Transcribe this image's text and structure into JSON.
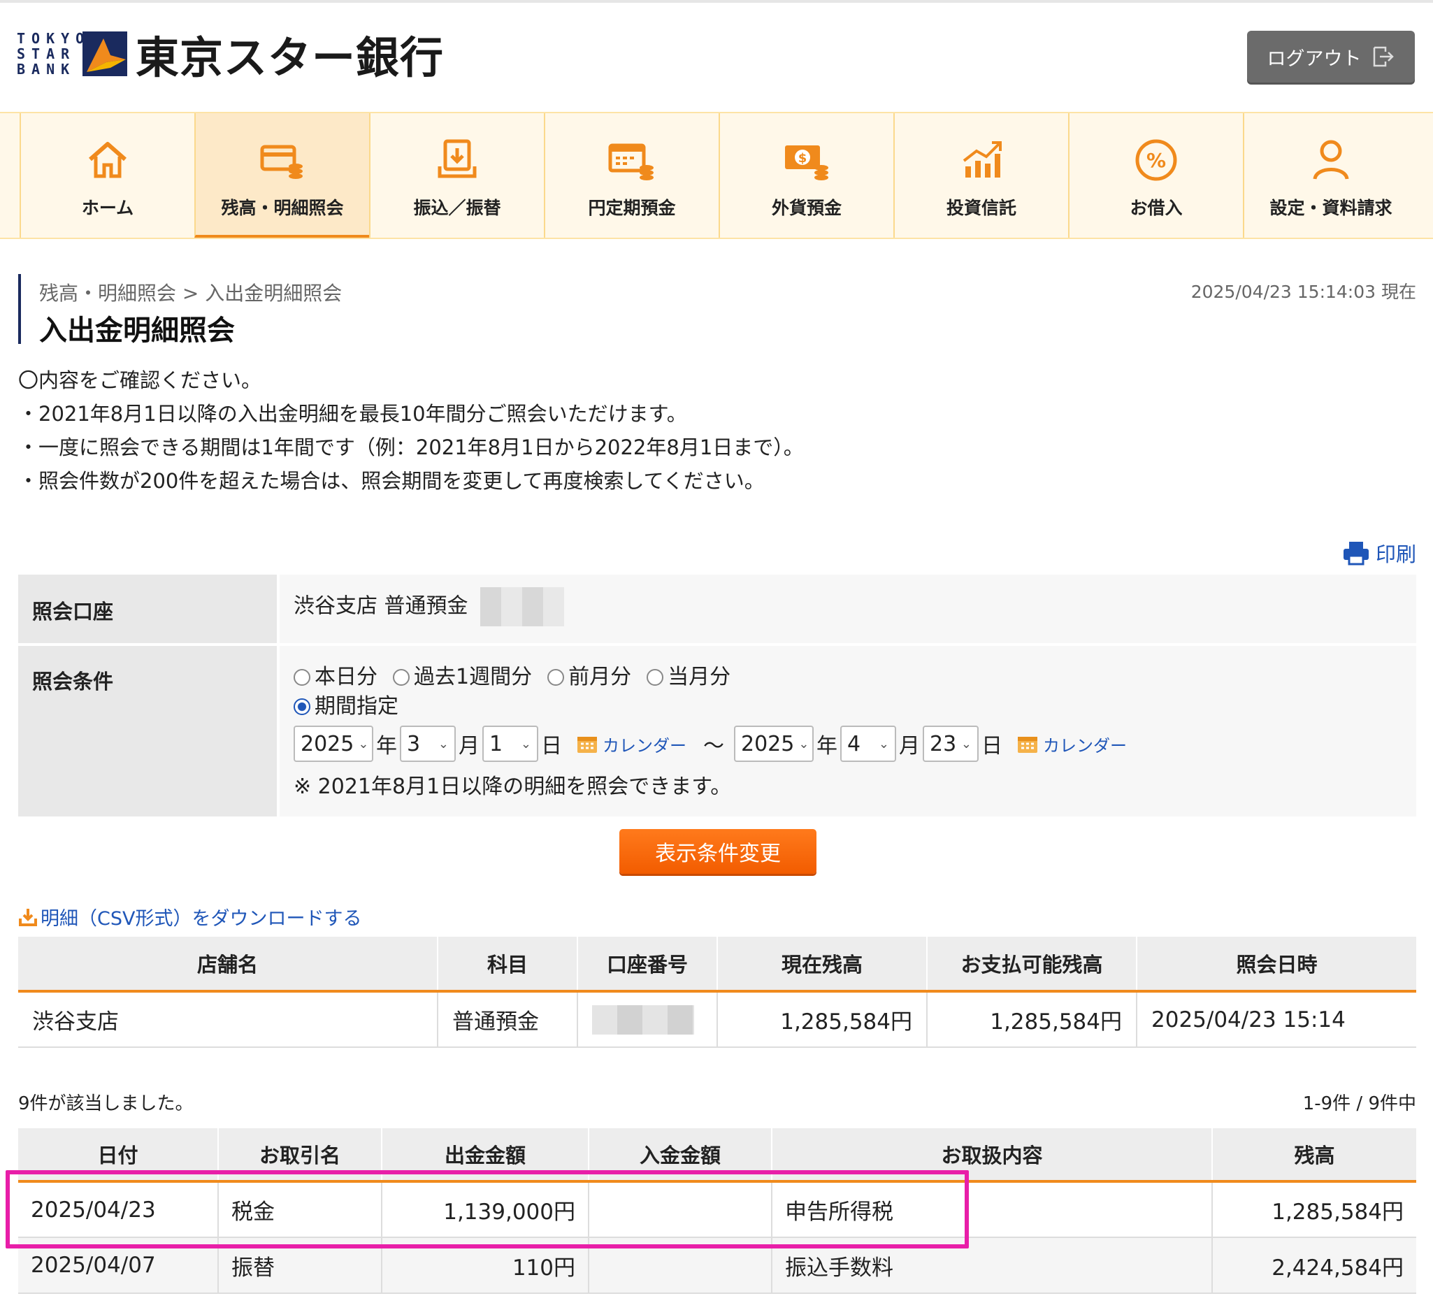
{
  "header": {
    "logo_en": "TOKYO STAR BANK",
    "logo_jp": "東京スター銀行",
    "logout_label": "ログアウト"
  },
  "nav": [
    {
      "label": "ホーム",
      "icon": "home-icon"
    },
    {
      "label": "残高・明細照会",
      "icon": "card-coins-icon",
      "active": true
    },
    {
      "label": "振込／振替",
      "icon": "transfer-download-icon"
    },
    {
      "label": "円定期預金",
      "icon": "calendar-coins-icon"
    },
    {
      "label": "外貨預金",
      "icon": "dollar-bill-icon"
    },
    {
      "label": "投資信託",
      "icon": "chart-up-icon"
    },
    {
      "label": "お借入",
      "icon": "percent-icon"
    },
    {
      "label": "設定・資料請求",
      "icon": "person-icon"
    }
  ],
  "page": {
    "breadcrumb": "残高・明細照会 > 入出金明細照会",
    "title": "入出金明細照会",
    "timestamp": "2025/04/23 15:14:03 現在",
    "notes": [
      "〇内容をご確認ください。",
      "・2021年8月1日以降の入出金明細を最長10年間分ご照会いただけます。",
      "・一度に照会できる期間は1年間です（例：2021年8月1日から2022年8月1日まで）。",
      "・照会件数が200件を超えた場合は、照会期間を変更して再度検索してください。"
    ],
    "print_label": "印刷"
  },
  "conditions": {
    "account_label": "照会口座",
    "account_value": "渋谷支店 普通預金",
    "condition_label": "照会条件",
    "radio_options": [
      "本日分",
      "過去1週間分",
      "前月分",
      "当月分"
    ],
    "period_option": "期間指定",
    "from": {
      "year": "2025",
      "month": "3",
      "day": "1"
    },
    "to": {
      "year": "2025",
      "month": "4",
      "day": "23"
    },
    "unit_year": "年",
    "unit_month": "月",
    "unit_day": "日",
    "tilde": "〜",
    "calendar_label": "カレンダー",
    "note": "※ 2021年8月1日以降の明細を照会できます。",
    "change_button": "表示条件変更"
  },
  "csv_link": "明細（CSV形式）をダウンロードする",
  "account_table": {
    "headers": [
      "店舗名",
      "科目",
      "口座番号",
      "現在残高",
      "お支払可能残高",
      "照会日時"
    ],
    "row": {
      "branch": "渋谷支店",
      "type": "普通預金",
      "current_balance": "1,285,584円",
      "available_balance": "1,285,584円",
      "query_time": "2025/04/23 15:14"
    }
  },
  "results": {
    "count_text": "9件が該当しました。",
    "range_text": "1-9件 / 9件中"
  },
  "transactions": {
    "headers": [
      "日付",
      "お取引名",
      "出金金額",
      "入金金額",
      "お取扱内容",
      "残高"
    ],
    "rows": [
      {
        "date": "2025/04/23",
        "name": "税金",
        "withdrawal": "1,139,000円",
        "deposit": "",
        "detail": "申告所得税",
        "balance": "1,285,584円"
      },
      {
        "date": "2025/04/07",
        "name": "振替",
        "withdrawal": "110円",
        "deposit": "",
        "detail": "振込手数料",
        "balance": "2,424,584円"
      }
    ]
  },
  "colors": {
    "accent_orange": "#f08a1c",
    "navy": "#1a2a5e",
    "link_blue": "#1f56b8",
    "highlight_magenta": "#e81ea8"
  }
}
